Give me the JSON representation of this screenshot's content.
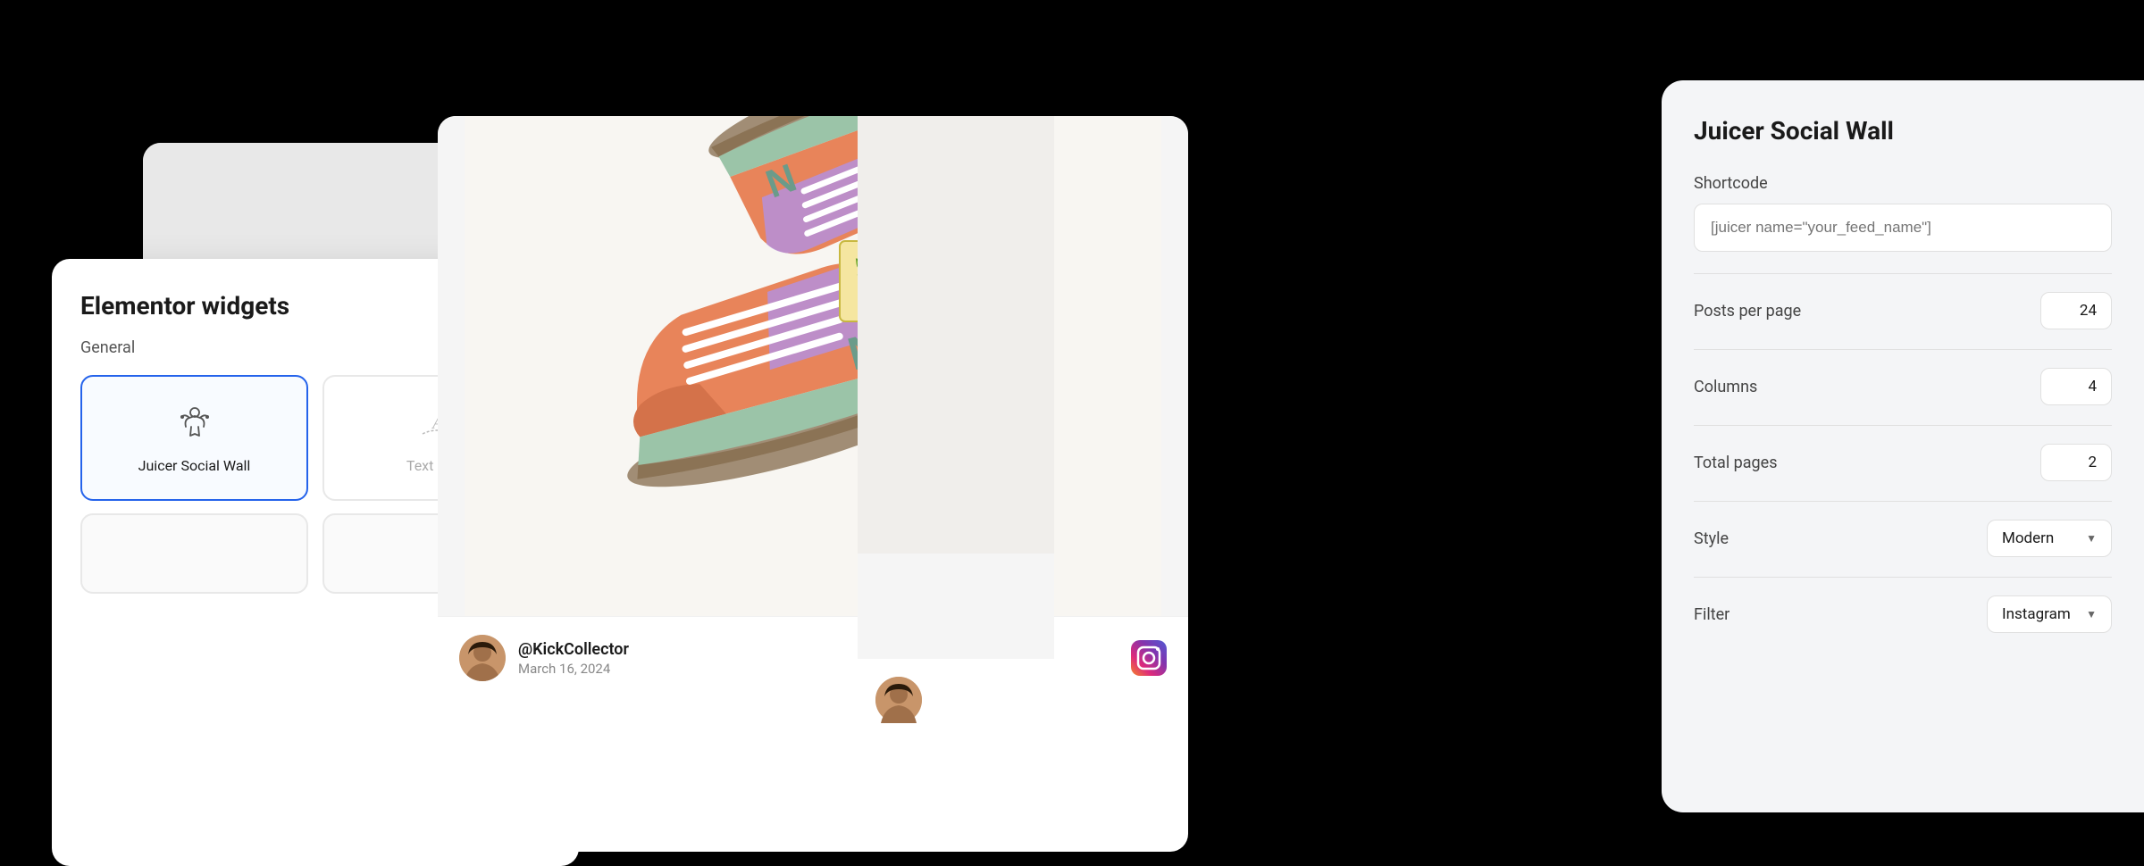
{
  "scene": {
    "background": "#000000"
  },
  "elementor_panel": {
    "title": "Elementor widgets",
    "section_label": "General",
    "widgets": [
      {
        "id": "juicer-social-wall",
        "label": "Juicer Social Wall",
        "icon": "juicer-icon",
        "active": true
      },
      {
        "id": "text-path",
        "label": "Text Path",
        "icon": "text-path-icon",
        "active": false
      }
    ]
  },
  "social_post": {
    "username": "@KickCollector",
    "date": "March 16, 2024",
    "platform": "instagram"
  },
  "settings_panel": {
    "title": "Juicer Social Wall",
    "shortcode_label": "Shortcode",
    "shortcode_placeholder": "[juicer name=\"your_feed_name\"]",
    "fields": [
      {
        "label": "Posts per page",
        "value": "24"
      },
      {
        "label": "Columns",
        "value": "4"
      },
      {
        "label": "Total pages",
        "value": "2"
      }
    ],
    "selects": [
      {
        "label": "Style",
        "value": "Modern"
      },
      {
        "label": "Filter",
        "value": "Instagram"
      }
    ]
  }
}
